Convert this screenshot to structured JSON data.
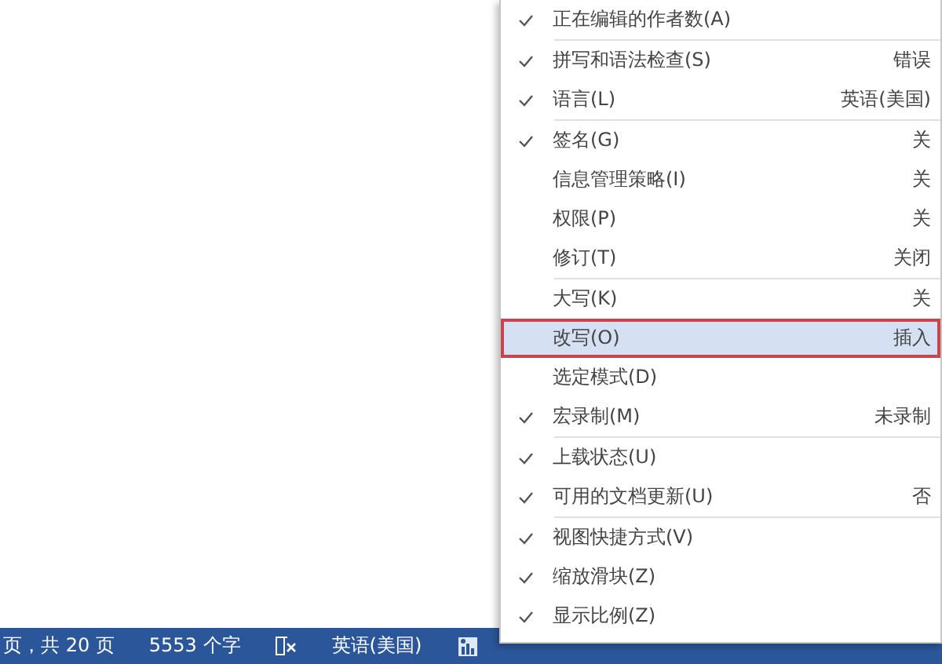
{
  "status_bar": {
    "items": [
      {
        "kind": "text",
        "text": "页，共 20 页"
      },
      {
        "kind": "text",
        "text": "5553 个字"
      },
      {
        "kind": "proofing-icon"
      },
      {
        "kind": "text",
        "text": "英语(美国)"
      },
      {
        "kind": "macro-icon"
      }
    ]
  },
  "context_menu": {
    "sections": [
      {
        "items": [
          {
            "label": "正在编辑的作者数(A)",
            "checked": true,
            "selected": false
          }
        ]
      },
      {
        "items": [
          {
            "label": "拼写和语法检查(S)",
            "value": "错误",
            "checked": true,
            "selected": false
          },
          {
            "label": "语言(L)",
            "value": "英语(美国)",
            "checked": true,
            "selected": false
          }
        ]
      },
      {
        "items": [
          {
            "label": "签名(G)",
            "value": "关",
            "checked": true,
            "selected": false
          },
          {
            "label": "信息管理策略(I)",
            "value": "关",
            "checked": false,
            "selected": false
          },
          {
            "label": "权限(P)",
            "value": "关",
            "checked": false,
            "selected": false
          },
          {
            "label": "修订(T)",
            "value": "关闭",
            "checked": false,
            "selected": false
          }
        ]
      },
      {
        "items": [
          {
            "label": "大写(K)",
            "value": "关",
            "checked": false,
            "selected": false
          },
          {
            "label": "改写(O)",
            "value": "插入",
            "checked": false,
            "selected": true
          },
          {
            "label": "选定模式(D)",
            "checked": false,
            "selected": false
          },
          {
            "label": "宏录制(M)",
            "value": "未录制",
            "checked": true,
            "selected": false
          }
        ]
      },
      {
        "items": [
          {
            "label": "上载状态(U)",
            "checked": true,
            "selected": false
          },
          {
            "label": "可用的文档更新(U)",
            "value": "否",
            "checked": true,
            "selected": false
          }
        ]
      },
      {
        "items": [
          {
            "label": "视图快捷方式(V)",
            "checked": true,
            "selected": false
          },
          {
            "label": "缩放滑块(Z)",
            "checked": true,
            "selected": false
          },
          {
            "label": "显示比例(Z)",
            "checked": true,
            "selected": false
          }
        ]
      }
    ]
  }
}
